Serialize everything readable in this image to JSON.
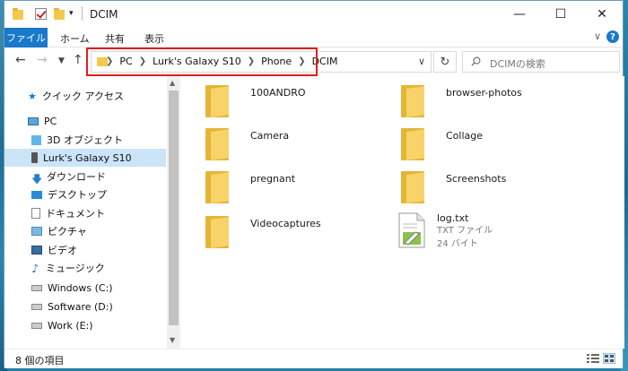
{
  "window": {
    "title": "DCIM"
  },
  "ribbon": {
    "tabs": [
      "ファイル",
      "ホーム",
      "共有",
      "表示"
    ]
  },
  "address": {
    "crumbs": [
      "PC",
      "Lurk's Galaxy S10",
      "Phone",
      "DCIM"
    ]
  },
  "search": {
    "placeholder": "DCIMの検索"
  },
  "sidebar": {
    "items": [
      {
        "label": "クイック アクセス",
        "icon": "star-icon"
      },
      {
        "label": "PC",
        "icon": "pc-icon"
      },
      {
        "label": "3D オブジェクト",
        "icon": "3d-objects-icon"
      },
      {
        "label": "Lurk's Galaxy S10",
        "icon": "phone-icon",
        "selected": true
      },
      {
        "label": "ダウンロード",
        "icon": "download-icon"
      },
      {
        "label": "デスクトップ",
        "icon": "desktop-icon"
      },
      {
        "label": "ドキュメント",
        "icon": "documents-icon"
      },
      {
        "label": "ピクチャ",
        "icon": "pictures-icon"
      },
      {
        "label": "ビデオ",
        "icon": "videos-icon"
      },
      {
        "label": "ミュージック",
        "icon": "music-icon"
      },
      {
        "label": "Windows (C:)",
        "icon": "drive-icon"
      },
      {
        "label": "Software (D:)",
        "icon": "drive-icon"
      },
      {
        "label": "Work (E:)",
        "icon": "drive-icon"
      }
    ]
  },
  "content": {
    "folders": [
      "100ANDRO",
      "browser-photos",
      "Camera",
      "Collage",
      "pregnant",
      "Screenshots",
      "Videocaptures"
    ],
    "file": {
      "name": "log.txt",
      "type": "TXT ファイル",
      "size": "24 バイト"
    }
  },
  "status": {
    "count": "8 個の項目"
  },
  "colors": {
    "accent": "#1979ca",
    "highlight_border": "#e01e1e",
    "selected_bg": "#cce4f7",
    "folder": "#f2c94c"
  }
}
